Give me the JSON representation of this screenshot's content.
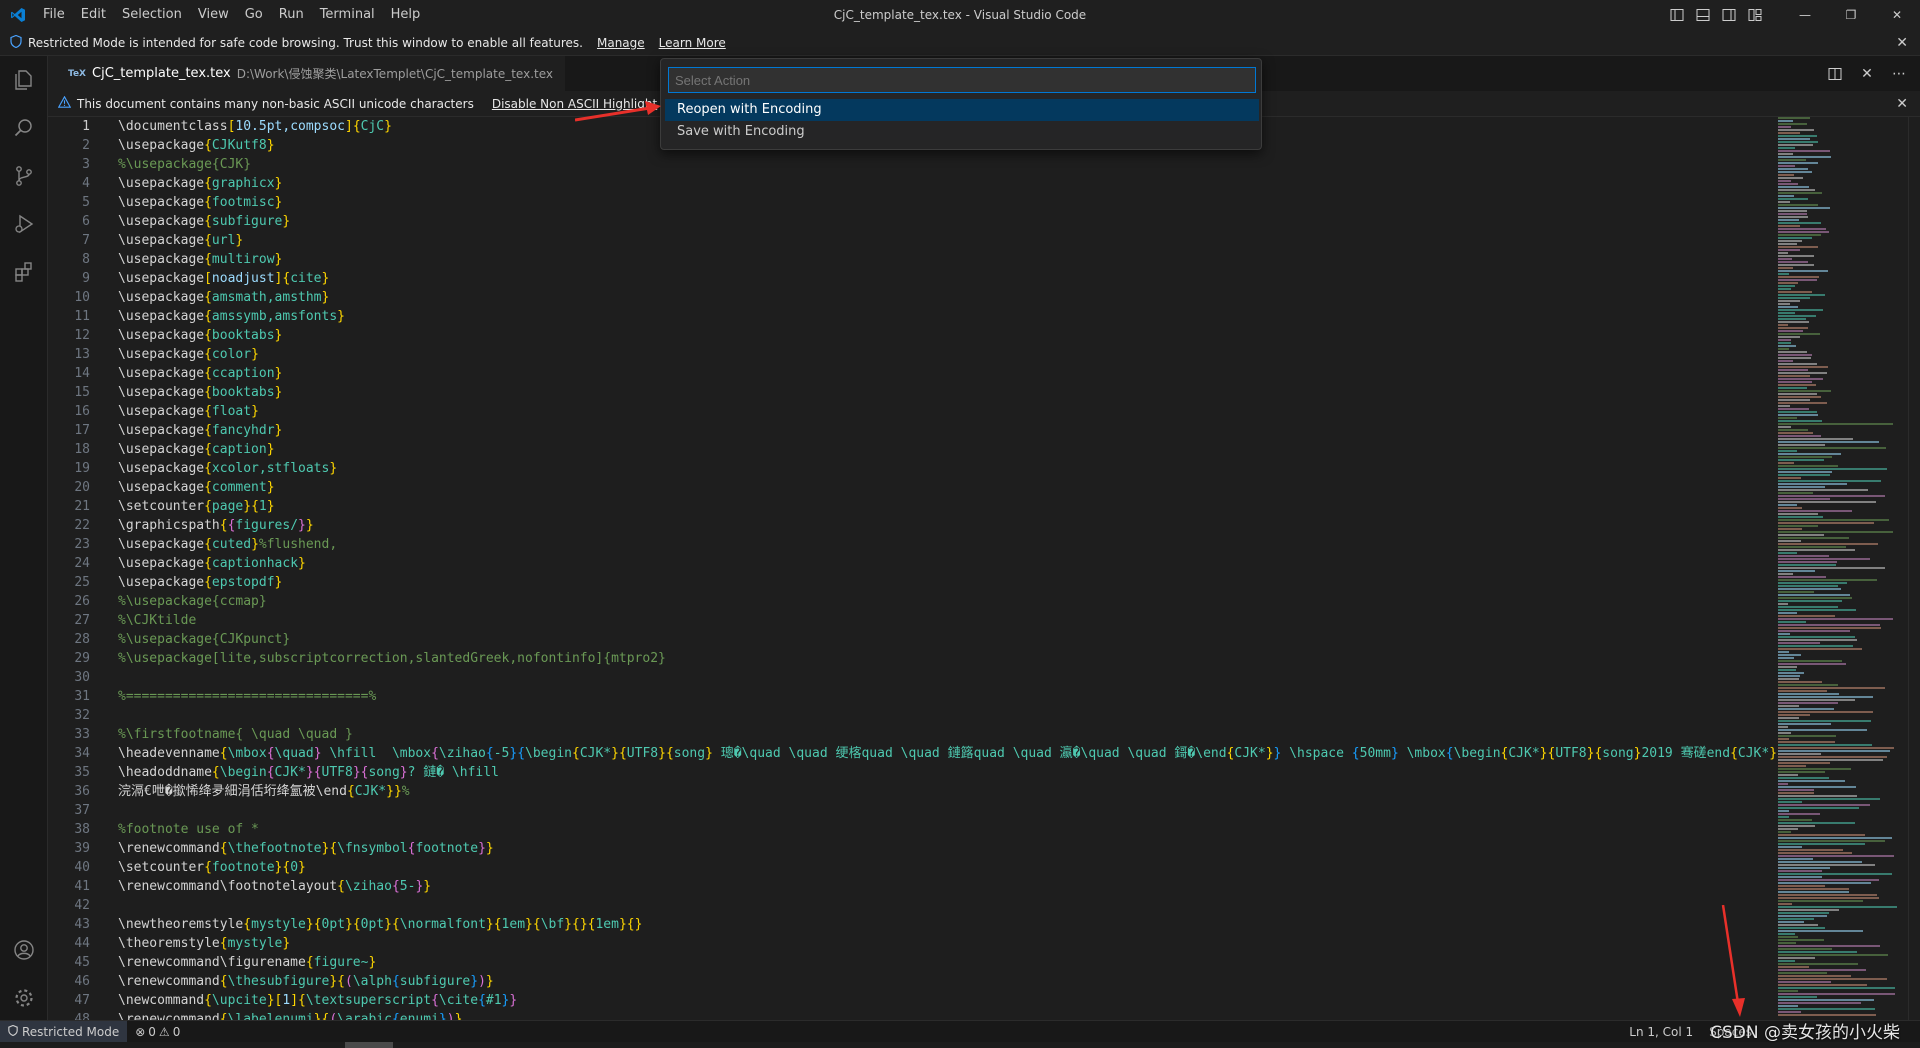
{
  "window": {
    "title": "CjC_template_tex.tex - Visual Studio Code",
    "menu": [
      "File",
      "Edit",
      "Selection",
      "View",
      "Go",
      "Run",
      "Terminal",
      "Help"
    ]
  },
  "banner": {
    "text": "Restricted Mode is intended for safe code browsing. Trust this window to enable all features.",
    "manage": "Manage",
    "learn_more": "Learn More"
  },
  "tab": {
    "icon": "TeX",
    "title": "CjC_template_tex.tex",
    "path": "D:\\Work\\侵蚀聚类\\LatexTemplet\\CjC_template_tex.tex"
  },
  "ascii_warning": {
    "text": "This document contains many non-basic ASCII unicode characters",
    "action": "Disable Non ASCII Highlight"
  },
  "quick_pick": {
    "placeholder": "Select Action",
    "items": [
      "Reopen with Encoding",
      "Save with Encoding"
    ]
  },
  "editor": {
    "lines": [
      "\\documentclass[10.5pt,compsoc]{CjC}",
      "\\usepackage{CJKutf8}",
      "%\\usepackage{CJK}",
      "\\usepackage{graphicx}",
      "\\usepackage{footmisc}",
      "\\usepackage{subfigure}",
      "\\usepackage{url}",
      "\\usepackage{multirow}",
      "\\usepackage[noadjust]{cite}",
      "\\usepackage{amsmath,amsthm}",
      "\\usepackage{amssymb,amsfonts}",
      "\\usepackage{booktabs}",
      "\\usepackage{color}",
      "\\usepackage{ccaption}",
      "\\usepackage{booktabs}",
      "\\usepackage{float}",
      "\\usepackage{fancyhdr}",
      "\\usepackage{caption}",
      "\\usepackage{xcolor,stfloats}",
      "\\usepackage{comment}",
      "\\setcounter{page}{1}",
      "\\graphicspath{{figures/}}",
      "\\usepackage{cuted}%flushend,",
      "\\usepackage{captionhack}",
      "\\usepackage{epstopdf}",
      "%\\usepackage{ccmap}",
      "%\\CJKtilde",
      "%\\usepackage{CJKpunct}",
      "%\\usepackage[lite,subscriptcorrection,slantedGreek,nofontinfo]{mtpro2}",
      "",
      "%===============================%",
      "",
      "%\\firstfootname{ \\quad \\quad }",
      "\\headevenname{\\mbox{\\quad} \\hfill  \\mbox{\\zihao{-5}{\\begin{CJK*}{UTF8}{song} 璁�\\quad \\quad 绠楁quad \\quad 鏈簬quad \\quad 瀛�\\quad \\quad 鎶�\\end{CJK*}} \\hspace {50mm} \\mbox{\\begin{CJK*}{UTF8}{song}2019 骞磋end{CJK*}}",
      "\\headoddname{\\begin{CJK*}{UTF8}{song}? 鏈� \\hfill",
      "浣滆€呭�撳悕绛夛細涓佸垳绛氳被\\end{CJK*}}%",
      "",
      "%footnote use of *",
      "\\renewcommand{\\thefootnote}{\\fnsymbol{footnote}}",
      "\\setcounter{footnote}{0}",
      "\\renewcommand\\footnotelayout{\\zihao{5-}}",
      "",
      "\\newtheoremstyle{mystyle}{0pt}{0pt}{\\normalfont}{1em}{\\bf}{}{1em}{}",
      "\\theoremstyle{mystyle}",
      "\\renewcommand\\figurename{figure~}",
      "\\renewcommand{\\thesubfigure}{(\\alph{subfigure})}",
      "\\newcommand{\\upcite}[1]{\\textsuperscript{\\cite{#1}}",
      "\\renewcommand{\\labelenumi}{(\\arabic{enumi})}"
    ]
  },
  "colors": {
    "keyword": "#d4d4d4",
    "brace": "#ffd700",
    "brace2": "#da70d6",
    "brace3": "#179fff",
    "arg": "#4ec9b0",
    "option": "#9cdcfe",
    "comment": "#6a9955",
    "accent": "#0078d4"
  },
  "status": {
    "restricted": "Restricted Mode",
    "errors": "0",
    "warnings": "0",
    "position": "Ln 1, Col 1",
    "spaces": "Spaces"
  },
  "watermark": "CSDN @卖女孩的小火柴"
}
